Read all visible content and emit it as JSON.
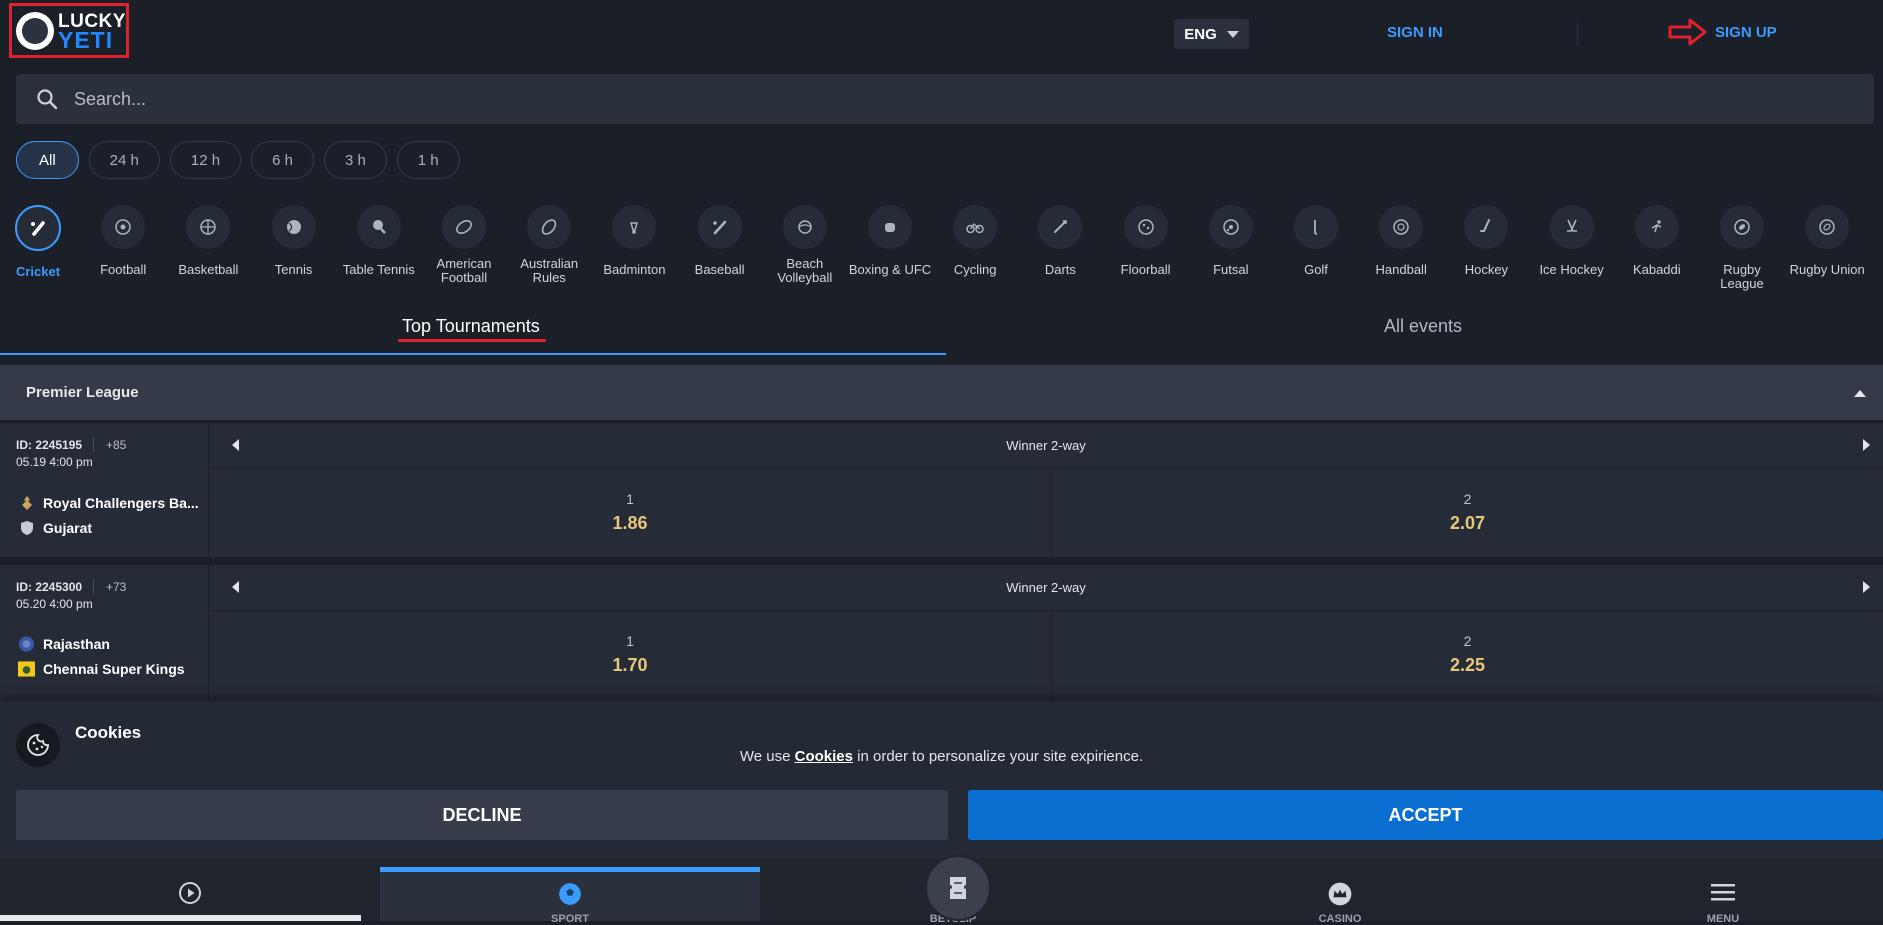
{
  "header": {
    "logo_top": "LUCKY",
    "logo_bottom": "YETI",
    "language": "ENG",
    "sign_in": "SIGN IN",
    "sign_up": "SIGN UP"
  },
  "search": {
    "placeholder": "Search..."
  },
  "time_filters": [
    "All",
    "24 h",
    "12 h",
    "6 h",
    "3 h",
    "1 h"
  ],
  "sports": [
    {
      "label": "Cricket",
      "icon": "cricket-icon",
      "active": true
    },
    {
      "label": "Football",
      "icon": "football-icon"
    },
    {
      "label": "Basketball",
      "icon": "basketball-icon"
    },
    {
      "label": "Tennis",
      "icon": "tennis-icon"
    },
    {
      "label": "Table Tennis",
      "icon": "table-tennis-icon"
    },
    {
      "label": "American Football",
      "icon": "american-football-icon"
    },
    {
      "label": "Australian Rules",
      "icon": "australian-rules-icon"
    },
    {
      "label": "Badminton",
      "icon": "badminton-icon"
    },
    {
      "label": "Baseball",
      "icon": "baseball-icon"
    },
    {
      "label": "Beach Volleyball",
      "icon": "beach-volleyball-icon"
    },
    {
      "label": "Boxing & UFC",
      "icon": "boxing-icon"
    },
    {
      "label": "Cycling",
      "icon": "cycling-icon"
    },
    {
      "label": "Darts",
      "icon": "darts-icon"
    },
    {
      "label": "Floorball",
      "icon": "floorball-icon"
    },
    {
      "label": "Futsal",
      "icon": "futsal-icon"
    },
    {
      "label": "Golf",
      "icon": "golf-icon"
    },
    {
      "label": "Handball",
      "icon": "handball-icon"
    },
    {
      "label": "Hockey",
      "icon": "hockey-icon"
    },
    {
      "label": "Ice Hockey",
      "icon": "ice-hockey-icon"
    },
    {
      "label": "Kabaddi",
      "icon": "kabaddi-icon"
    },
    {
      "label": "Rugby League",
      "icon": "rugby-league-icon"
    },
    {
      "label": "Rugby Union",
      "icon": "rugby-union-icon"
    }
  ],
  "tabs": {
    "top": "Top Tournaments",
    "all": "All events"
  },
  "league": {
    "name": "Premier League"
  },
  "events": [
    {
      "id": "ID: 2245195",
      "more": "+85",
      "time": "05.19 4:00 pm",
      "team1": "Royal Challengers Ba...",
      "team2": "Gujarat",
      "market": "Winner 2-way",
      "odds": [
        {
          "key": "1",
          "value": "1.86"
        },
        {
          "key": "2",
          "value": "2.07"
        }
      ]
    },
    {
      "id": "ID: 2245300",
      "more": "+73",
      "time": "05.20 4:00 pm",
      "team1": "Rajasthan",
      "team2": "Chennai Super Kings",
      "market": "Winner 2-way",
      "odds": [
        {
          "key": "1",
          "value": "1.70"
        },
        {
          "key": "2",
          "value": "2.25"
        }
      ]
    }
  ],
  "cookies": {
    "title": "Cookies",
    "text_before": "We use ",
    "link": "Cookies",
    "text_after": " in order to personalize your site expirience.",
    "decline": "DECLINE",
    "accept": "ACCEPT"
  },
  "bottom_nav": {
    "items": [
      "SPORT",
      "BETSLIP",
      "CASINO",
      "MENU"
    ]
  },
  "colors": {
    "accent": "#3b9bff",
    "accept": "#0a6fd1",
    "odds": "#e8c77a",
    "highlight": "#e0222e"
  }
}
